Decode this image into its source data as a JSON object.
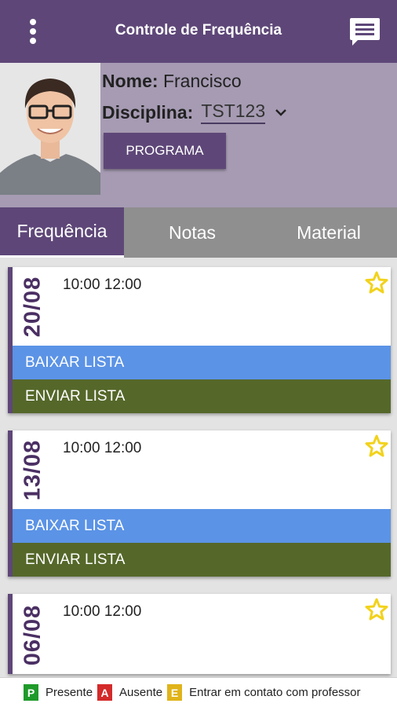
{
  "appbar": {
    "title": "Controle de Frequência",
    "menu_icon": "more-vert-icon",
    "chat_icon": "chat-icon"
  },
  "profile": {
    "name_label": "Nome:",
    "name_value": "Francisco",
    "discipline_label": "Disciplina:",
    "discipline_value": "TST123",
    "program_button": "PROGRAMA"
  },
  "tabs": [
    {
      "label": "Frequência",
      "active": true
    },
    {
      "label": "Notas",
      "active": false
    },
    {
      "label": "Material",
      "active": false
    }
  ],
  "sessions": [
    {
      "date": "20/08",
      "time": "10:00 12:00",
      "download": "BAIXAR LISTA",
      "send": "ENVIAR LISTA"
    },
    {
      "date": "13/08",
      "time": "10:00 12:00",
      "download": "BAIXAR LISTA",
      "send": "ENVIAR LISTA"
    },
    {
      "date": "06/08",
      "time": "10:00 12:00"
    }
  ],
  "legend": [
    {
      "letter": "P",
      "label": "Presente",
      "color": "#1f9a2a"
    },
    {
      "letter": "A",
      "label": "Ausente",
      "color": "#d42a2a"
    },
    {
      "letter": "E",
      "label": "Entrar em contato com professor",
      "color": "#e0b31a"
    }
  ],
  "colors": {
    "primary": "#5e4778",
    "download": "#5b93e6",
    "send": "#55682a",
    "star": "#f2d21b"
  }
}
